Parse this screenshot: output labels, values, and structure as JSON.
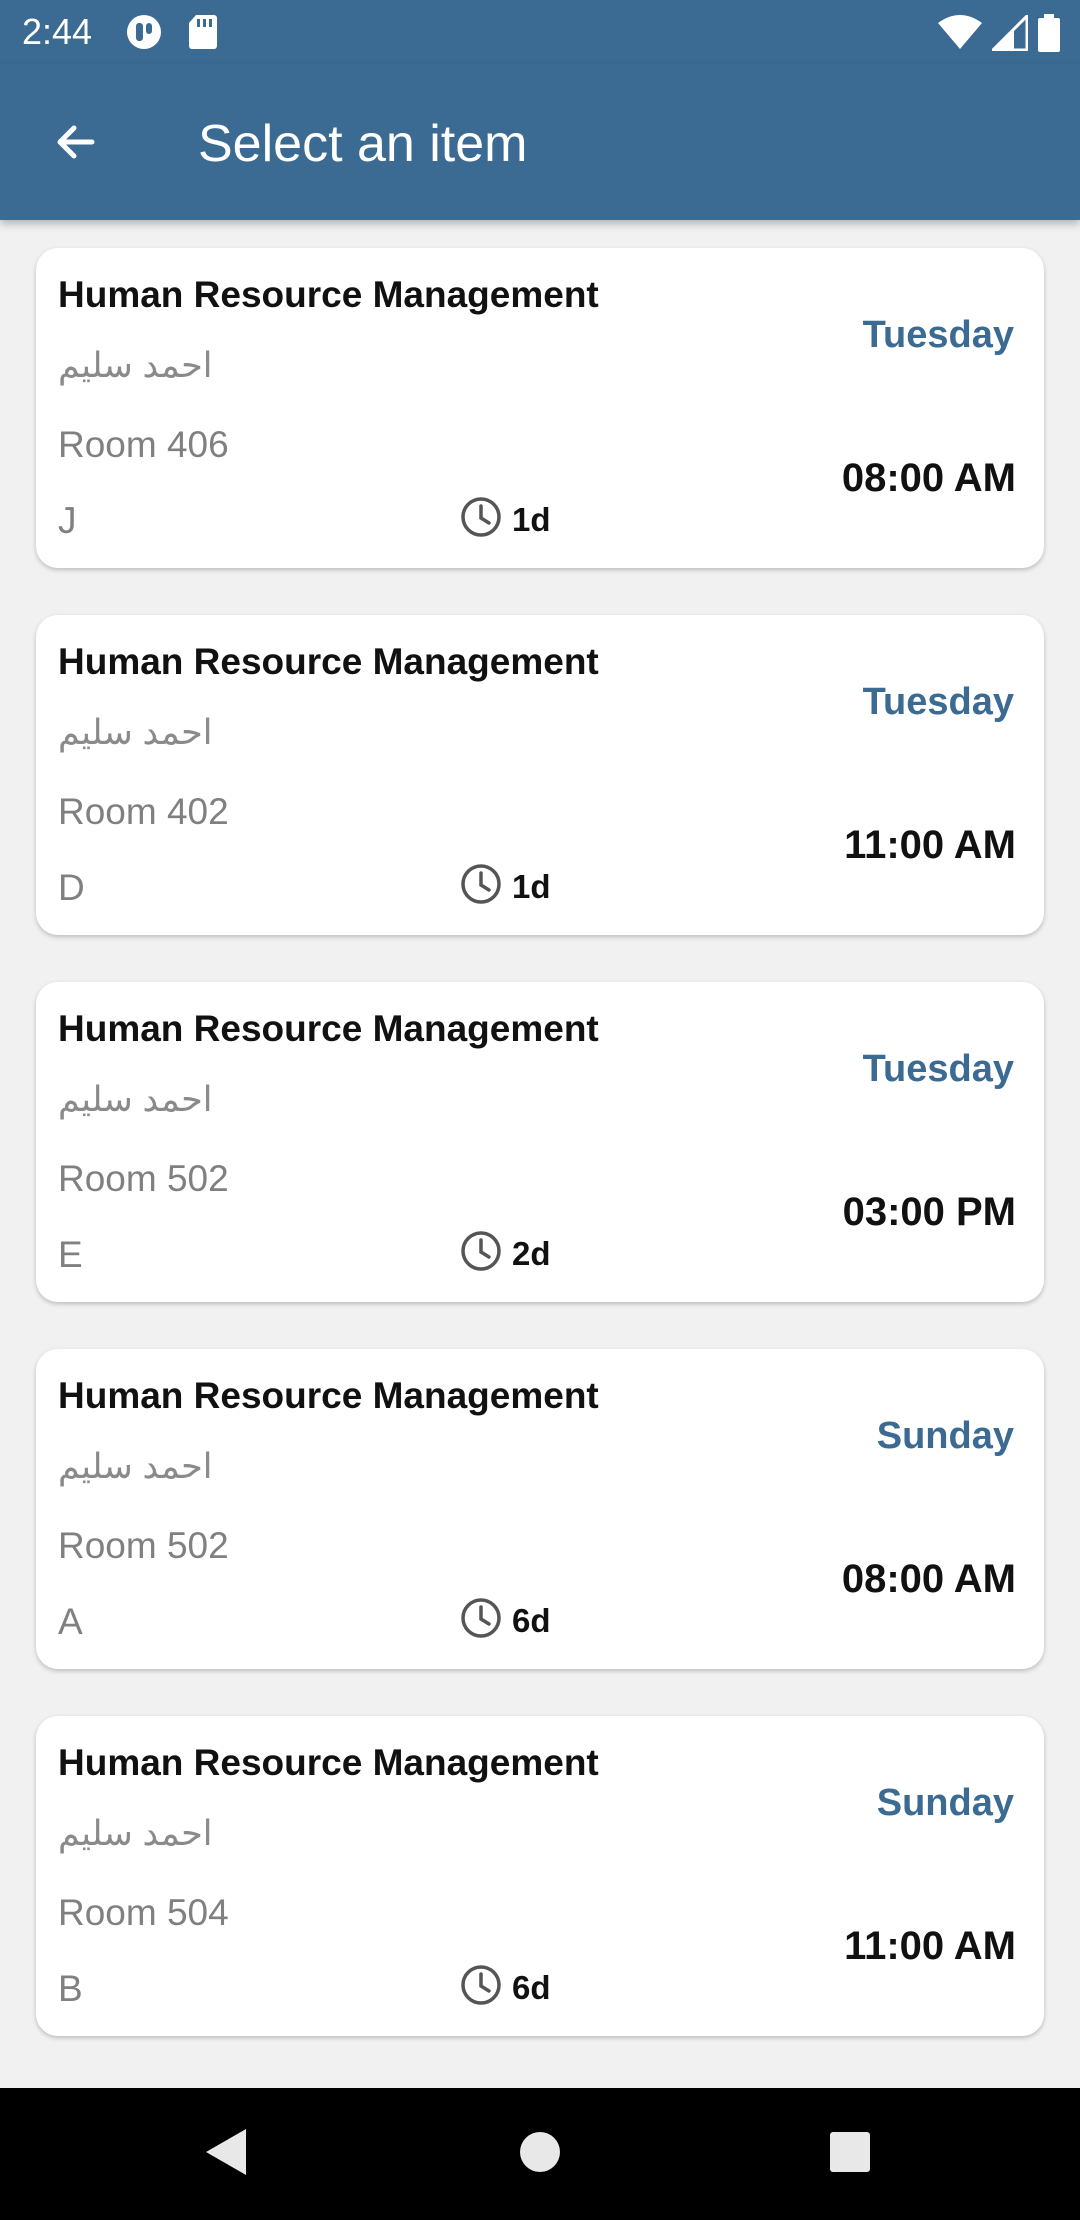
{
  "status_bar": {
    "time": "2:44",
    "left_icons": [
      "notification-app-icon",
      "sd-card-icon"
    ],
    "right_icons": [
      "wifi-icon",
      "signal-icon",
      "battery-icon"
    ]
  },
  "app_bar": {
    "title": "Select an item",
    "background_color": "#3b6a92"
  },
  "colors": {
    "day_accent": "#3b6a92"
  },
  "items": [
    {
      "course": "Human Resource Management",
      "instructor": "احمد سليم",
      "room": "Room 406",
      "group": "J",
      "duration": "1d",
      "day": "Tuesday",
      "time": "08:00 AM"
    },
    {
      "course": "Human Resource Management",
      "instructor": "احمد سليم",
      "room": "Room 402",
      "group": "D",
      "duration": "1d",
      "day": "Tuesday",
      "time": "11:00 AM"
    },
    {
      "course": "Human Resource Management",
      "instructor": "احمد سليم",
      "room": "Room 502",
      "group": "E",
      "duration": "2d",
      "day": "Tuesday",
      "time": "03:00 PM"
    },
    {
      "course": "Human Resource Management",
      "instructor": "احمد سليم",
      "room": "Room 502",
      "group": "A",
      "duration": "6d",
      "day": "Sunday",
      "time": "08:00 AM"
    },
    {
      "course": "Human Resource Management",
      "instructor": "احمد سليم",
      "room": "Room 504",
      "group": "B",
      "duration": "6d",
      "day": "Sunday",
      "time": "11:00 AM"
    }
  ],
  "nav_bar": {
    "buttons": [
      "back-icon",
      "home-icon",
      "recents-icon"
    ]
  }
}
